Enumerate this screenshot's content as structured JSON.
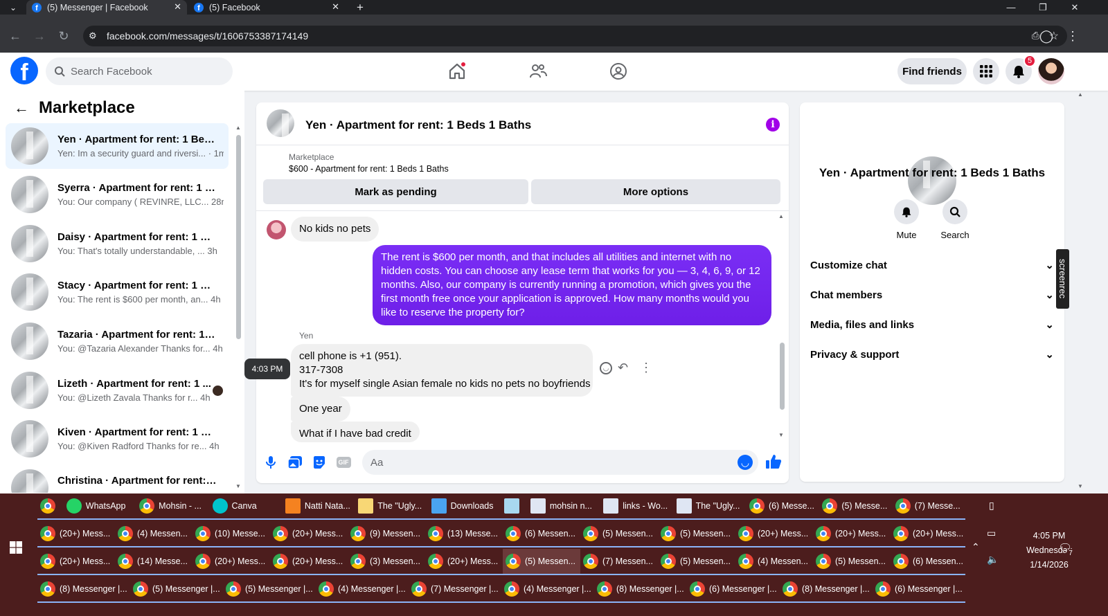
{
  "browser": {
    "tabs": [
      {
        "title": "(5) Messenger | Facebook",
        "active": true
      },
      {
        "title": "(5) Facebook",
        "active": false
      }
    ],
    "new_tab": "+",
    "url": "facebook.com/messages/t/1606753387174149"
  },
  "fb_header": {
    "search_placeholder": "Search Facebook",
    "find_friends": "Find friends",
    "notification_count": "5"
  },
  "sidebar": {
    "title": "Marketplace",
    "conversations": [
      {
        "name": "Yen · Apartment for rent: 1 Beds ...",
        "preview": "Yen: Im a security guard and riversi... · 1m",
        "selected": true
      },
      {
        "name": "Syerra · Apartment for rent: 1 Be...",
        "preview": "You: Our company ( REVINRE, LLC...  28m",
        "selected": false
      },
      {
        "name": "Daisy · Apartment for rent: 1 Be...",
        "preview": "You: That's totally understandable, ...  3h",
        "selected": false
      },
      {
        "name": "Stacy · Apartment for rent: 1 Bed...",
        "preview": "You: The rent is $600 per month, an...  4h",
        "selected": false
      },
      {
        "name": "Tazaria · Apartment for rent: 1 B...",
        "preview": "You: @Tazaria Alexander Thanks for...  4h",
        "selected": false
      },
      {
        "name": "Lizeth · Apartment for rent: 1 ...",
        "preview": "You: @Lizeth Zavala Thanks for r...  4h",
        "selected": false
      },
      {
        "name": "Kiven · Apartment for rent: 1 Be...",
        "preview": "You: @Kiven Radford Thanks for re...  4h",
        "selected": false
      },
      {
        "name": "Christina · Apartment for rent: 1 ...",
        "preview": "",
        "selected": false
      }
    ]
  },
  "chat": {
    "title": "Yen · Apartment for rent: 1 Beds 1 Baths",
    "marketplace_label": "Marketplace",
    "listing": "$600 - Apartment for rent: 1 Beds 1 Baths",
    "mark_pending": "Mark as pending",
    "more_options": "More options",
    "msg_no_kids": "No kids no pets",
    "msg_out": "The rent is $600 per month, and that includes all utilities and internet with no hidden costs. You can choose any lease term that works for you — 3, 4, 6, 9, or 12 months. Also, our company is currently running a promotion, which gives you the first month free once your application is approved. How many months would you like to reserve the property for?",
    "sender_name": "Yen",
    "msg_phone_1": "cell phone is +1 (951).",
    "msg_phone_2": "317-7308",
    "msg_phone_3": "It's for myself single Asian female no kids no pets no boyfriends",
    "time_tooltip": "4:03 PM",
    "msg_one_year": "One year",
    "msg_bad_credit": "What if I have bad credit",
    "composer_placeholder": "Aa"
  },
  "details": {
    "title": "Yen · Apartment for rent: 1 Beds 1 Baths",
    "mute": "Mute",
    "search": "Search",
    "rows": [
      "Customize chat",
      "Chat members",
      "Media, files and links",
      "Privacy & support"
    ],
    "screenrec": "screenrec"
  },
  "taskbar": {
    "row1": [
      {
        "label": "",
        "icon": "chrome"
      },
      {
        "label": "WhatsApp",
        "icon": "whatsapp"
      },
      {
        "label": "Mohsin - ...",
        "icon": "chrome"
      },
      {
        "label": "Canva",
        "icon": "canva"
      },
      {
        "label": "Natti Nata...",
        "icon": "vlc"
      },
      {
        "label": "The \"Ugly...",
        "icon": "folder"
      },
      {
        "label": "Downloads",
        "icon": "download"
      },
      {
        "label": "",
        "icon": "notepad"
      },
      {
        "label": "mohsin n...",
        "icon": "doc"
      },
      {
        "label": "links - Wo...",
        "icon": "doc"
      },
      {
        "label": "The \"Ugly...",
        "icon": "doc"
      },
      {
        "label": "(6) Messe...",
        "icon": "chrome"
      },
      {
        "label": "(5) Messe...",
        "icon": "chrome"
      },
      {
        "label": "(7) Messe...",
        "icon": "chrome"
      }
    ],
    "row2": [
      "(20+) Mess...",
      "(4) Messen...",
      "(10) Messe...",
      "(20+) Mess...",
      "(9) Messen...",
      "(13) Messe...",
      "(6) Messen...",
      "(5) Messen...",
      "(5) Messen...",
      "(20+) Mess...",
      "(20+) Mess...",
      "(20+) Mess..."
    ],
    "row3": [
      "(20+) Mess...",
      "(14) Messe...",
      "(20+) Mess...",
      "(20+) Mess...",
      "(3) Messen...",
      "(20+) Mess...",
      "(5) Messen...",
      "(7) Messen...",
      "(5) Messen...",
      "(4) Messen...",
      "(5) Messen...",
      "(6) Messen..."
    ],
    "row4": [
      "(8) Messenger |...",
      "(5) Messenger |...",
      "(5) Messenger |...",
      "(4) Messenger |...",
      "(7) Messenger |...",
      "(4) Messenger |...",
      "(8) Messenger |...",
      "(6) Messenger |...",
      "(8) Messenger |...",
      "(6) Messenger |..."
    ],
    "time": "4:05 PM",
    "day": "Wednesday",
    "date": "1/14/2026",
    "notif_count": "7"
  }
}
